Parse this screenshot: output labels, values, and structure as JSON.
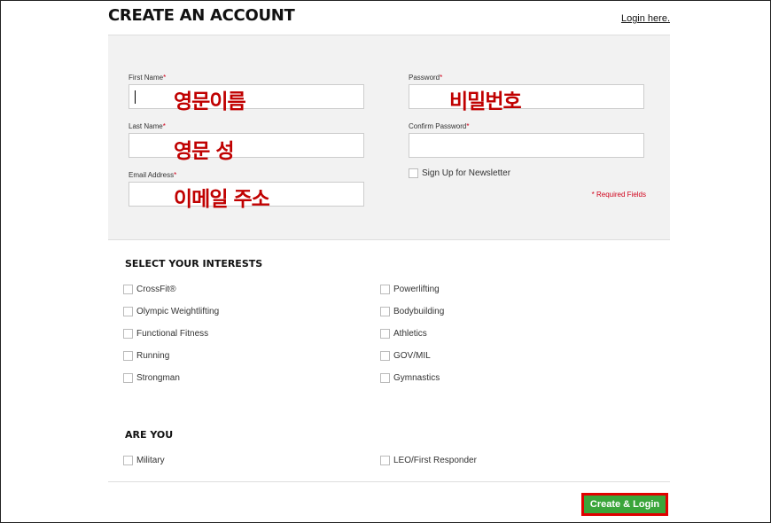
{
  "header": {
    "title": "CREATE AN ACCOUNT",
    "login_link": "Login here."
  },
  "form": {
    "first_name": {
      "label": "First Name",
      "required_mark": "*",
      "overlay": "영문이름"
    },
    "last_name": {
      "label": "Last Name",
      "required_mark": "*",
      "overlay": "영문 성"
    },
    "email": {
      "label": "Email Address",
      "required_mark": "*",
      "overlay": "이메일 주소"
    },
    "password": {
      "label": "Password",
      "required_mark": "*",
      "overlay": "비밀번호"
    },
    "confirm_password": {
      "label": "Confirm Password",
      "required_mark": "*"
    },
    "newsletter": {
      "label": "Sign Up for Newsletter"
    },
    "required_note": "* Required Fields"
  },
  "interests": {
    "title": "SELECT YOUR INTERESTS",
    "left": [
      "CrossFit®",
      "Olympic Weightlifting",
      "Functional Fitness",
      "Running",
      "Strongman"
    ],
    "right": [
      "Powerlifting",
      "Bodybuilding",
      "Athletics",
      "GOV/MIL",
      "Gymnastics"
    ]
  },
  "are_you": {
    "title": "ARE YOU",
    "options": [
      "Military",
      "LEO/First Responder"
    ]
  },
  "submit": {
    "label": "Create & Login"
  },
  "colors": {
    "required": "#d0021b",
    "overlay_text": "#c00000",
    "submit_bg": "#3aa53a",
    "submit_border": "#e00000"
  }
}
